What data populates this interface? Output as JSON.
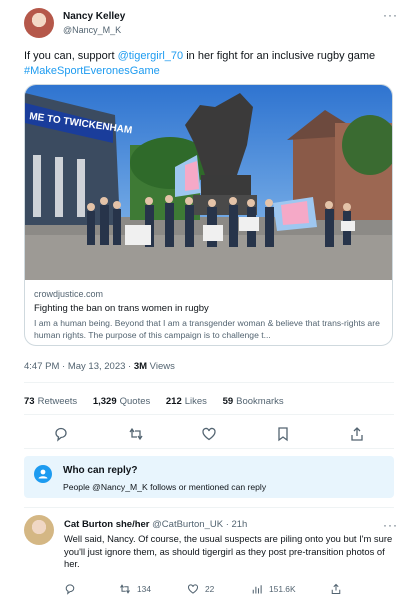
{
  "author": {
    "name": "Nancy Kelley",
    "handle": "@Nancy_M_K"
  },
  "tweet": {
    "text_pre": "If you can, support ",
    "mention": "@tigergirl_70",
    "text_post": " in her fight for an inclusive rugby game",
    "hashtag": "#MakeSportEveronesGame"
  },
  "card": {
    "domain": "crowdjustice.com",
    "title": "Fighting the ban on trans women in rugby",
    "description": "I am a human being. Beyond that I am a transgender woman & believe that trans-rights are human rights. The purpose of this campaign is to challenge t...",
    "image_sign": "ME TO TWICKENHAM"
  },
  "meta": {
    "time": "4:47 PM · May 13, 2023 · ",
    "views_count": "3M",
    "views_label": " Views"
  },
  "stats": {
    "retweets": {
      "count": "73",
      "label": "Retweets"
    },
    "quotes": {
      "count": "1,329",
      "label": "Quotes"
    },
    "likes": {
      "count": "212",
      "label": "Likes"
    },
    "bookmarks": {
      "count": "59",
      "label": "Bookmarks"
    }
  },
  "reply_box": {
    "title": "Who can reply?",
    "subtitle": "People @Nancy_M_K follows or mentioned can reply"
  },
  "reply": {
    "name": "Cat Burton she/her",
    "meta": " @CatBurton_UK · 21h",
    "text": "Well said, Nancy. Of course, the usual suspects are piling onto you but I'm sure you'll just ignore them, as should tigergirl as they post pre-transition photos of her.",
    "retweets": "134",
    "likes": "22",
    "views": "151.6K"
  },
  "icons": {
    "more": "···"
  },
  "colors": {
    "accent": "#1d9bf0",
    "muted": "#536471"
  }
}
